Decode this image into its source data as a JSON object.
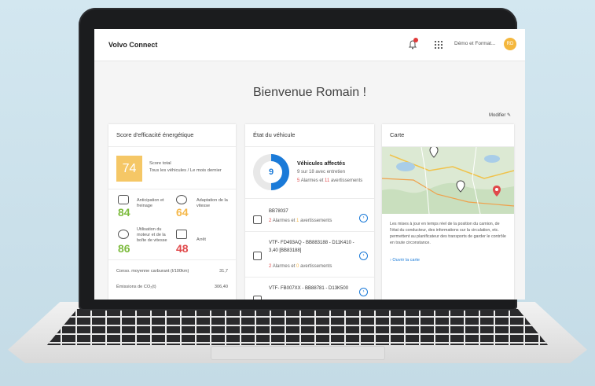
{
  "app": {
    "title": "Volvo Connect",
    "user": "Démo et Format...",
    "avatar": "RD"
  },
  "welcome": "Bienvenue Romain !",
  "modify": "Modifier",
  "energy": {
    "title": "Score d'efficacité énergétique",
    "score": "74",
    "score_label": "Score total",
    "score_sub": "Tous les véhicules / Le mois dernier",
    "metrics": [
      {
        "label": "Anticipation et freinage",
        "value": "84"
      },
      {
        "label": "Adaptation de la vitesse",
        "value": "64"
      },
      {
        "label": "Utilisation du moteur et de la boîte de vitesse",
        "value": "86"
      },
      {
        "label": "Arrêt",
        "value": "48"
      }
    ],
    "rows": [
      {
        "label": "Conso. moyenne carburant (l/100km)",
        "value": "31,7"
      },
      {
        "label": "Émissions de CO₂(t)",
        "value": "306,40"
      }
    ]
  },
  "vehicle": {
    "title": "État du véhicule",
    "donut_value": "9",
    "affected_label": "Véhicules affectés",
    "affected_sub": "9 sur 18 avec entretien",
    "alarms_count": "5",
    "alarms_text": "Alarmes et",
    "warnings_count": "11",
    "warnings_text": "avertissements",
    "items": [
      {
        "name": "BB78037",
        "alarms": "2",
        "warnings": "1"
      },
      {
        "name": "VTF- FD493AQ - BB883188 - D11K410 - 3,40 [BB83188]",
        "alarms": "2",
        "warnings": "0"
      },
      {
        "name": "VTF- FB007XX - BB88781 - D13K500",
        "alarms": "",
        "warnings": ""
      }
    ],
    "alarm_word": "Alarmes et",
    "warn_word": "avertissements"
  },
  "map": {
    "title": "Carte",
    "text": "Les mises à jour en temps réel de la position du camion, de l'état du conducteur, des informations sur la circulation, etc. permettent au planificateur des transports de garder le contrôle en toute circonstance.",
    "link": "Ouvrir la carte"
  },
  "colors": {
    "accent": "#1a7ad8",
    "score": "#f5c766",
    "good": "#7dbb3e",
    "medium": "#f5b84a",
    "bad": "#e0484a"
  }
}
